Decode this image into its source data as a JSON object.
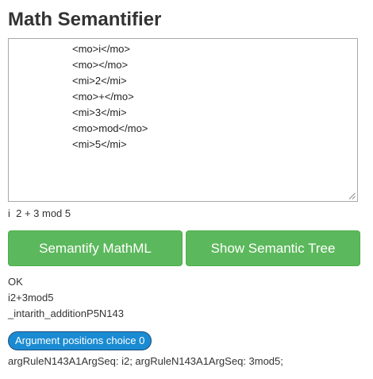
{
  "app": {
    "title": "Math Semantifier"
  },
  "editor": {
    "lines": [
      "<mo>i</mo>",
      "<mo></mo>",
      "<mi>2</mi>",
      "<mo>+</mo>",
      "<mi>3</mi>",
      "<mo>mod</mo>",
      "<mi>5</mi>"
    ]
  },
  "rendered_formula": "i  2 + 3 mod 5",
  "buttons": {
    "semantify_label": "Semantify MathML",
    "show_tree_label": "Show Semantic Tree"
  },
  "output": {
    "status": "OK",
    "linear": "i2+3mod5",
    "name": "_intarith_additionP5N143",
    "choice_label": "Argument positions choice 0",
    "arguments": "argRuleN143A1ArgSeq: i2; argRuleN143A1ArgSeq: 3mod5;"
  },
  "colors": {
    "button_green": "#5cb85c",
    "pill_blue": "#1a8bd2"
  },
  "icons": {
    "resize_grip": "resize-grip-icon"
  }
}
